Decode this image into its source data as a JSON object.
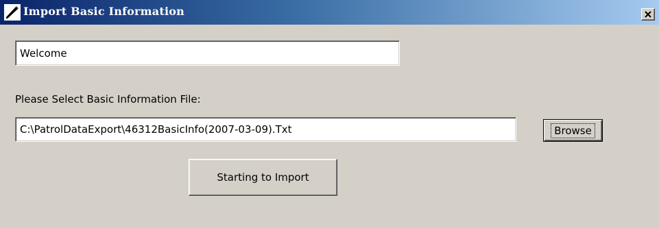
{
  "window": {
    "title": "Import Basic Information",
    "title_icon": "pencil-icon",
    "close_label": "×"
  },
  "main": {
    "welcome_text": "Welcome",
    "file_label": "Please Select Basic Information File:",
    "file_path": "C:\\PatrolDataExport\\46312BasicInfo(2007-03-09).Txt",
    "browse_label": "Browse",
    "import_label": "Starting to Import"
  },
  "colors": {
    "face": "#d4d0c8",
    "title_start": "#0a246a",
    "title_end": "#a6caf0"
  }
}
